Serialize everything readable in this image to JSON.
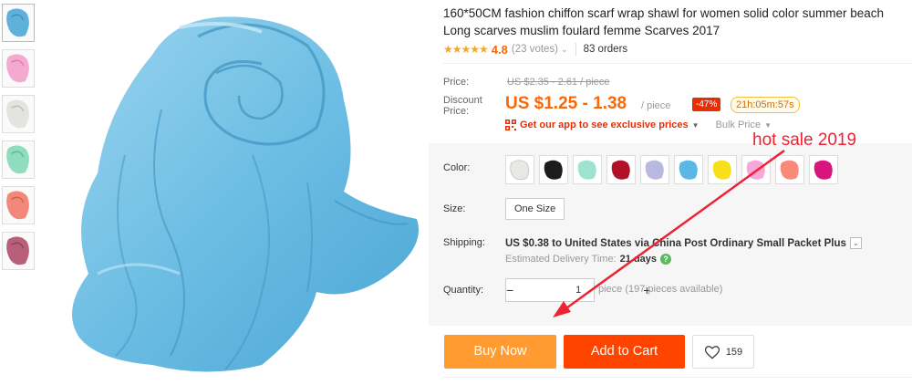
{
  "product": {
    "title": "160*50CM fashion chiffon scarf wrap shawl for women solid color summer beach Long scarves muslim foulard femme Scarves 2017",
    "stars": "★★★★★",
    "rating": "4.8",
    "votes": "(23 votes)",
    "orders": "83 orders"
  },
  "price": {
    "price_label": "Price:",
    "original": "US $2.35 - 2.61 / piece",
    "discount_label_1": "Discount",
    "discount_label_2": "Price:",
    "discount_value": "US $1.25 - 1.38",
    "per_piece": "/ piece",
    "discount_pct": "-47%",
    "timer": "21h:05m:57s",
    "app_promo": "Get our app to see exclusive prices",
    "bulk": "Bulk Price"
  },
  "options": {
    "color_label": "Color:",
    "size_label": "Size:",
    "size_value": "One Size",
    "colors": [
      "#e8e8e4",
      "#1c1c1c",
      "#9fe3cf",
      "#b1122a",
      "#b9b9e0",
      "#5bb7e6",
      "#f7e01a",
      "#f7a8d8",
      "#f98a7a",
      "#d8157f"
    ]
  },
  "shipping": {
    "label": "Shipping:",
    "cost": "US $0.38",
    "dest": "to United States via China Post Ordinary Small Packet Plus",
    "est_label": "Estimated Delivery Time:",
    "est_days": "21 days"
  },
  "quantity": {
    "label": "Quantity:",
    "minus": "−",
    "plus": "+",
    "value": "1",
    "available": "piece (197 pieces available)"
  },
  "actions": {
    "buy_now": "Buy Now",
    "add_to_cart": "Add to Cart",
    "wish_count": "159"
  },
  "thumbnails": [
    "#5fb0db",
    "#f4a9cf",
    "#e3e3e0",
    "#8fdcbf",
    "#f2877a",
    "#b8607a"
  ],
  "main_color": "#78c3e6",
  "annotation": "hot sale 2019"
}
